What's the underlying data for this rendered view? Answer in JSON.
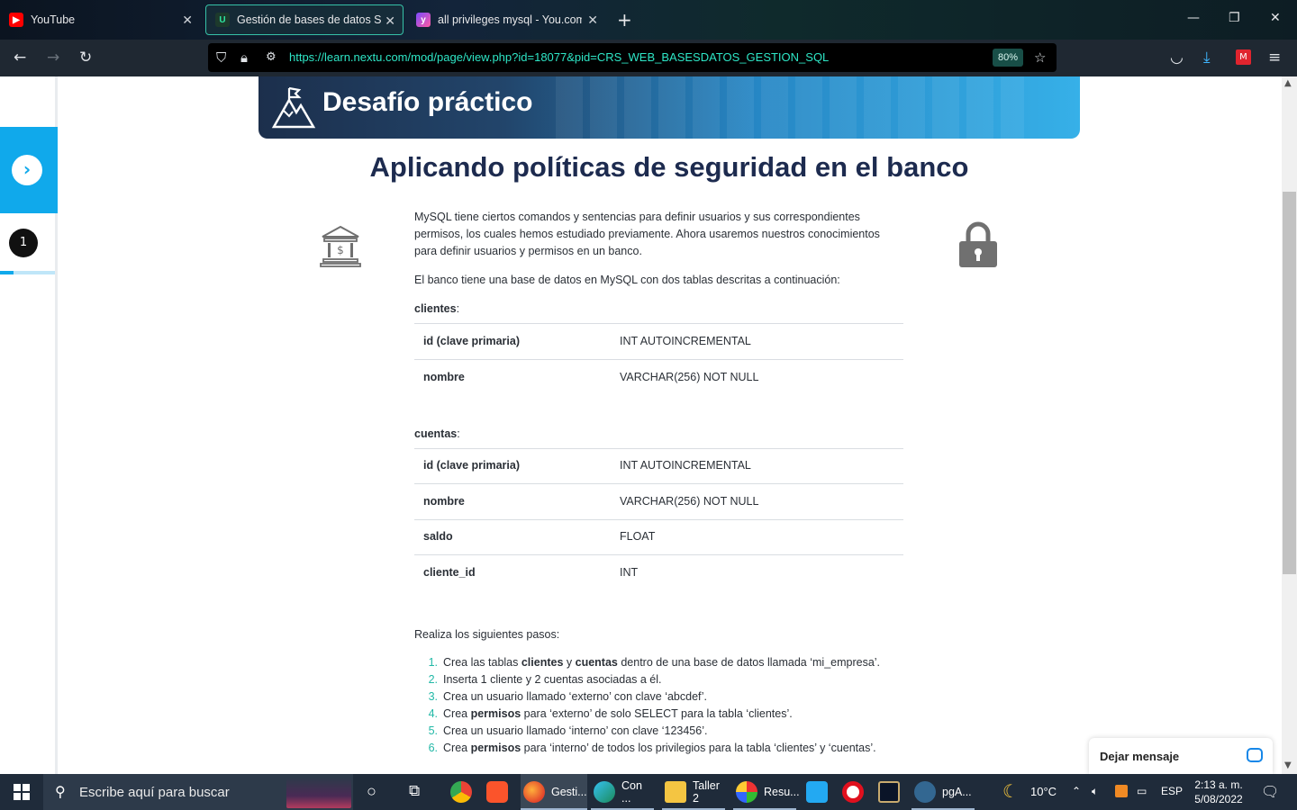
{
  "browser": {
    "tabs": [
      {
        "title": "YouTube",
        "favicon": "youtube-icon"
      },
      {
        "title": "Gestión de bases de datos SQL: ",
        "favicon": "nextu-icon",
        "active": true
      },
      {
        "title": "all privileges mysql - You.com |",
        "favicon": "youcom-icon"
      }
    ],
    "new_tab": "+",
    "window_controls": {
      "minimize": "—",
      "maximize": "❐",
      "close": "✕"
    },
    "url": "https://learn.nextu.com/mod/page/view.php?id=18077&pid=CRS_WEB_BASESDATOS_GESTION_SQL",
    "zoom": "80%"
  },
  "sidebar": {
    "current_step": "1",
    "progress_fraction": 0.25
  },
  "banner": {
    "title": "Desafío práctico"
  },
  "page": {
    "title": "Aplicando políticas de seguridad en el banco",
    "intro": "MySQL tiene ciertos comandos y sentencias para definir usuarios y sus correspondientes permisos, los cuales hemos estudiado previamente. Ahora usaremos nuestros conocimientos para definir usuarios y permisos en un banco.",
    "desc": "El banco tiene una base de datos en MySQL con dos tablas descritas a continuación:",
    "table1_label": "clientes",
    "table1": [
      {
        "field": "id (clave primaria)",
        "type": "INT AUTOINCREMENTAL"
      },
      {
        "field": "nombre",
        "type": "VARCHAR(256) NOT NULL"
      }
    ],
    "table2_label": "cuentas",
    "table2": [
      {
        "field": "id (clave primaria)",
        "type": "INT AUTOINCREMENTAL"
      },
      {
        "field": "nombre",
        "type": "VARCHAR(256) NOT NULL"
      },
      {
        "field": "saldo",
        "type": "FLOAT"
      },
      {
        "field": "cliente_id",
        "type": "INT"
      }
    ],
    "steps_intro": "Realiza los siguientes pasos:",
    "steps": [
      {
        "n": "1.",
        "a": "Crea las tablas ",
        "b": "clientes",
        "c": " y ",
        "d": "cuentas",
        "e": " dentro de una base de datos llamada ‘mi_empresa’."
      },
      {
        "n": "2.",
        "a": "Inserta 1 cliente y 2 cuentas asociadas a él."
      },
      {
        "n": "3.",
        "a": "Crea un usuario llamado ‘externo’ con clave ‘abcdef’."
      },
      {
        "n": "4.",
        "a": "Crea ",
        "b": "permisos",
        "c": " para ‘externo’ de solo SELECT para la tabla ‘clientes’."
      },
      {
        "n": "5.",
        "a": "Crea un usuario llamado ‘interno’ con clave ‘123456’."
      },
      {
        "n": "6.",
        "a": "Crea ",
        "b": "permisos",
        "c": " para ‘interno’ de todos los privilegios para la tabla ‘clientes’ y ‘cuentas’."
      }
    ]
  },
  "chat": {
    "label": "Dejar mensaje"
  },
  "taskbar": {
    "search_placeholder": "Escribe aquí para buscar",
    "apps": [
      {
        "label": "Gesti...",
        "icon": "firefox-icon"
      },
      {
        "label": "Con ...",
        "icon": "edge-icon"
      },
      {
        "label": "Taller 2",
        "icon": "folder-icon"
      },
      {
        "label": "Resu...",
        "icon": "paint-icon"
      },
      {
        "label": "pgA...",
        "icon": "pgadmin-icon"
      }
    ],
    "weather": "10°C",
    "lang": "ESP",
    "time": "2:13 a. m.",
    "date": "5/08/2022"
  }
}
